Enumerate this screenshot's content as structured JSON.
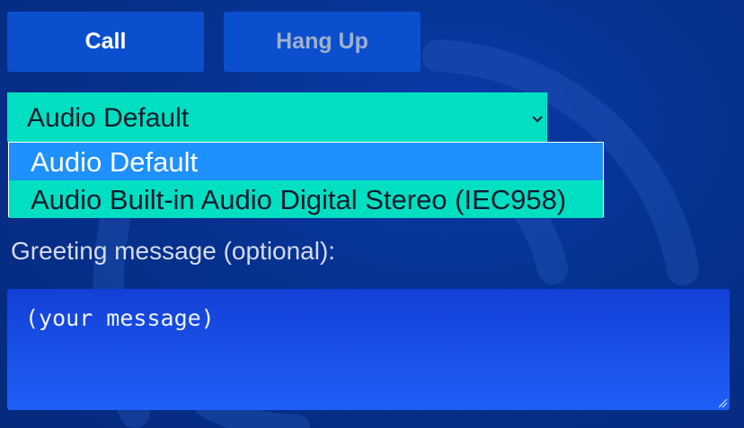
{
  "buttons": {
    "call_label": "Call",
    "hangup_label": "Hang Up"
  },
  "audio_select": {
    "selected_value": "Audio Default",
    "options": [
      "Audio Default",
      "Audio Built-in Audio Digital Stereo (IEC958)"
    ],
    "highlighted_index": 0
  },
  "greeting": {
    "label": "Greeting message (optional):",
    "placeholder": "(your message)"
  },
  "colors": {
    "background": "#052a7c",
    "button": "#0b4fce",
    "select": "#00dfc2",
    "option_highlight": "#1e90ff",
    "textarea": "#1f5ff8"
  },
  "icons": {
    "background_art": "signal-arcs-icon",
    "select_chevron": "chevron-down-icon",
    "resize": "resize-grip-icon"
  }
}
